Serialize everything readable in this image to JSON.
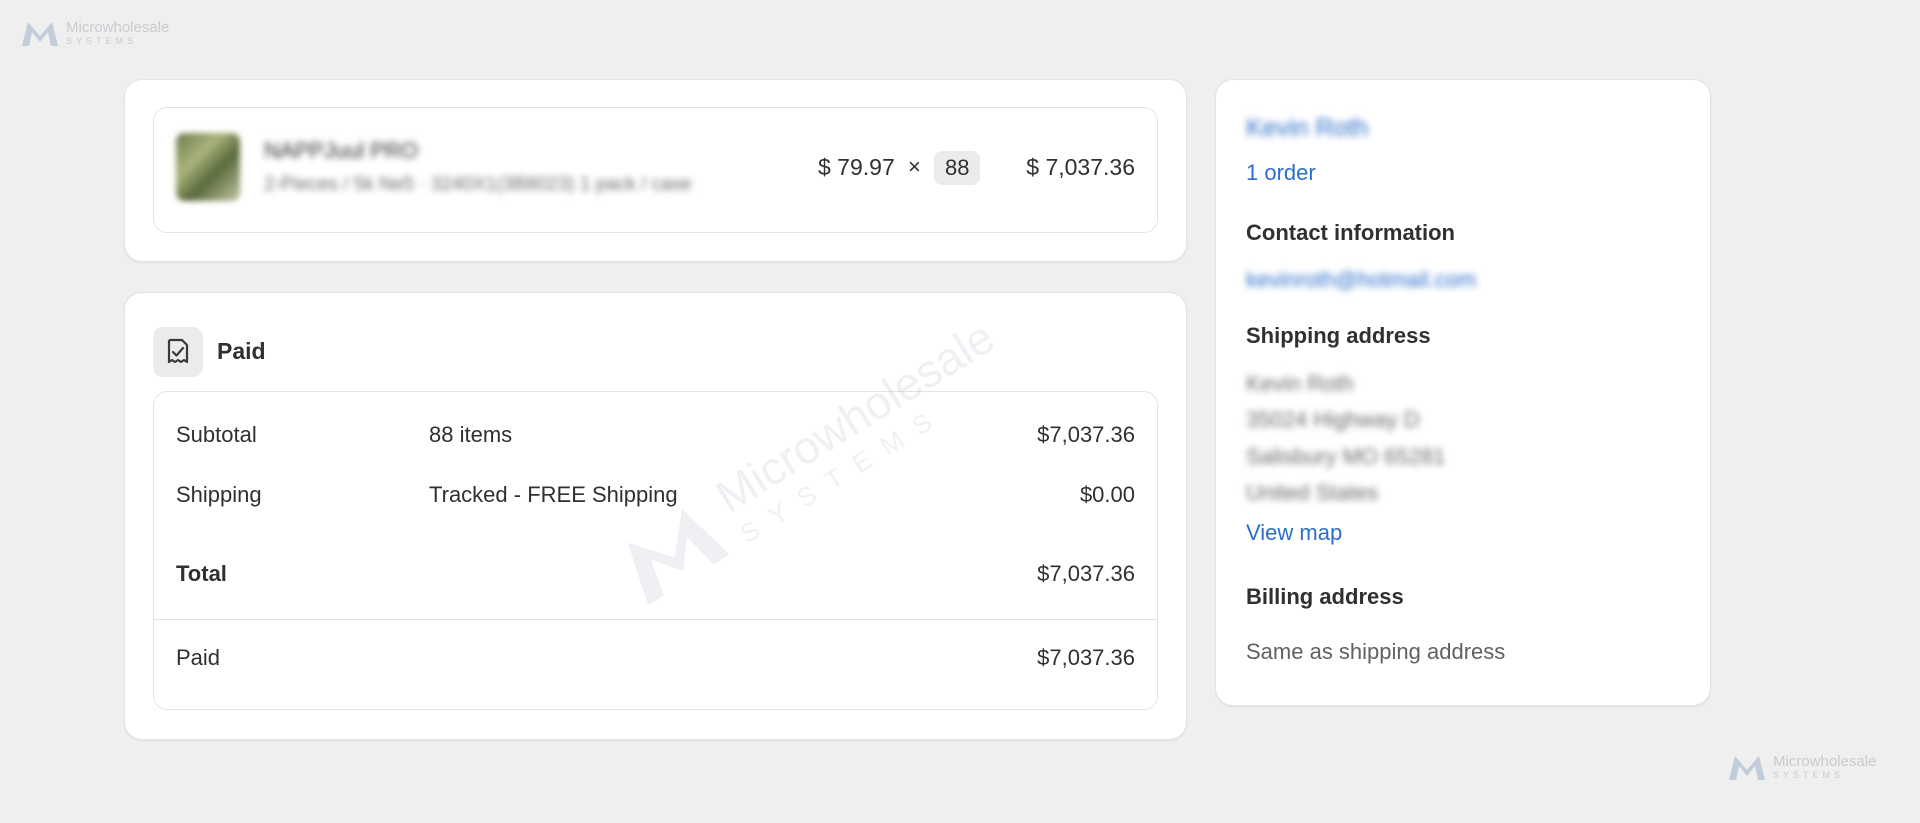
{
  "brand": {
    "name": "Microwholesale",
    "sub": "SYSTEMS",
    "accent": "#2c6ecb"
  },
  "line_item": {
    "product_name": "NAPPJuul PRO",
    "variant": "2-Pieces / 5k Ne5 · 3240X1(3B8023) 1 pack / case",
    "unit_price": "$ 79.97",
    "times": "×",
    "quantity": "88",
    "total": "$ 7,037.36"
  },
  "payment": {
    "icon": "receipt-check-icon",
    "status_title": "Paid",
    "rows": [
      {
        "label": "Subtotal",
        "desc": "88 items",
        "amount": "$7,037.36"
      },
      {
        "label": "Shipping",
        "desc": "Tracked - FREE Shipping",
        "amount": "$0.00"
      },
      {
        "label": "Total",
        "desc": "",
        "amount": "$7,037.36"
      }
    ],
    "paid_label": "Paid",
    "paid_amount": "$7,037.36"
  },
  "customer": {
    "name": "Kevin Roth",
    "orders_link": "1 order",
    "contact_title": "Contact information",
    "email": "kevinroth@hotmail.com",
    "shipping_title": "Shipping address",
    "shipping_lines": [
      "Kevin Roth",
      "35024 Highway D",
      "Salisbury MO 65281",
      "United States"
    ],
    "view_map": "View map",
    "billing_title": "Billing address",
    "billing_same": "Same as shipping address"
  }
}
